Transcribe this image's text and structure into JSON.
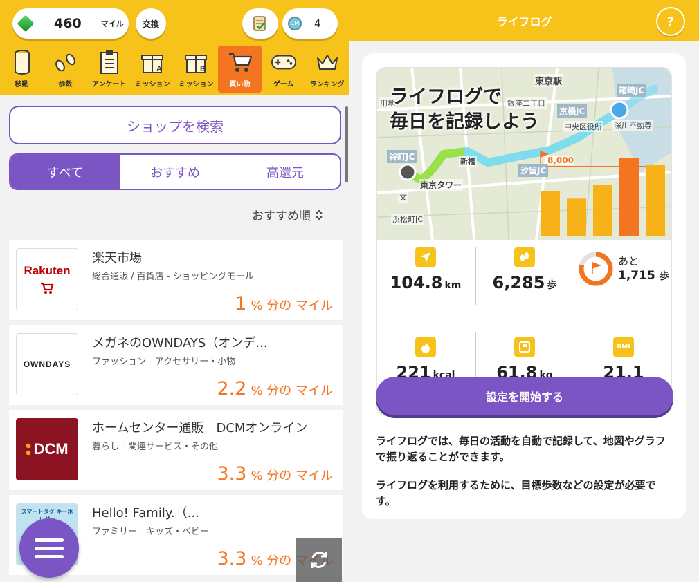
{
  "header": {
    "miles_value": "460",
    "miles_unit": "マイル",
    "exchange_label": "交換",
    "coin_count": "4",
    "coin_glyph": "CM"
  },
  "nav": [
    {
      "label": "移動",
      "icon": "cylinder-icon"
    },
    {
      "label": "歩数",
      "icon": "footprints-icon"
    },
    {
      "label": "アンケート",
      "icon": "survey-icon"
    },
    {
      "label": "ミッション",
      "icon": "gift-a-icon"
    },
    {
      "label": "ミッション",
      "icon": "gift-b-icon"
    },
    {
      "label": "買い物",
      "icon": "cart-icon",
      "active": true
    },
    {
      "label": "ゲーム",
      "icon": "gamepad-icon"
    },
    {
      "label": "ランキング",
      "icon": "crown-icon"
    }
  ],
  "search": {
    "label": "ショップを検索"
  },
  "filters": {
    "all": "すべて",
    "recommended": "おすすめ",
    "high_return": "高還元"
  },
  "sort": {
    "label": "おすすめ順"
  },
  "shops": [
    {
      "name": "楽天市場",
      "category": "総合通販 / 百貨店 - ショッピングモール",
      "rate": "1",
      "suffix": "% 分の マイル",
      "logo_text": "Rakuten"
    },
    {
      "name": "メガネのOWNDAYS（オンデ...",
      "category": "ファッション - アクセサリー・小物",
      "rate": "2.2",
      "suffix": "% 分の マイル",
      "logo_text": "OWNDAYS"
    },
    {
      "name": "ホームセンター通販　DCMオンライン",
      "category": "暮らし - 関連サービス・その他",
      "rate": "3.3",
      "suffix": "% 分の マイル",
      "logo_text": "DCM"
    },
    {
      "name": "Hello! Family.（...",
      "category": "ファミリー - キッズ・ベビー",
      "rate": "3.3",
      "suffix": "% 分の マイル",
      "logo_text": "スマートタグ キーホルダー"
    }
  ],
  "lifelog": {
    "title": "ライフログ",
    "help": "?",
    "hero_line1": "ライフログで",
    "hero_line2": "毎日を記録しよう",
    "goal": "8,000",
    "map_labels": [
      "東京駅",
      "箱崎JC",
      "京橋JC",
      "中央区役所",
      "深川不動尊",
      "谷町JC",
      "新橋",
      "汐留JC",
      "東京タワー",
      "用地",
      "文",
      "銀座二丁目",
      "浜松町JC"
    ],
    "bar_chart": {
      "values": [
        0.58,
        0.48,
        0.66,
        1.0,
        0.92
      ],
      "highlight_index": 3,
      "goal_fraction": 0.98
    },
    "stats": {
      "distance": {
        "value": "104.8",
        "unit": "km"
      },
      "steps": {
        "value": "6,285",
        "unit": "歩"
      },
      "remaining_label": "あと",
      "remaining_value": "1,715",
      "remaining_unit": "歩",
      "remaining_progress": 0.79,
      "calories": {
        "value": "221",
        "unit": "kcal"
      },
      "weight": {
        "value": "61.8",
        "unit": "kg"
      },
      "bmi_label": "BMI",
      "bmi_value": "21.1"
    },
    "start_button": "設定を開始する",
    "desc1": "ライフログでは、毎日の活動を自動で記録して、地図やグラフで振り返ることができます。",
    "desc2": "ライフログを利用するために、目標歩数などの設定が必要です。"
  },
  "colors": {
    "yellow": "#f7c21a",
    "purple": "#7b55c4",
    "orange": "#f37521"
  }
}
